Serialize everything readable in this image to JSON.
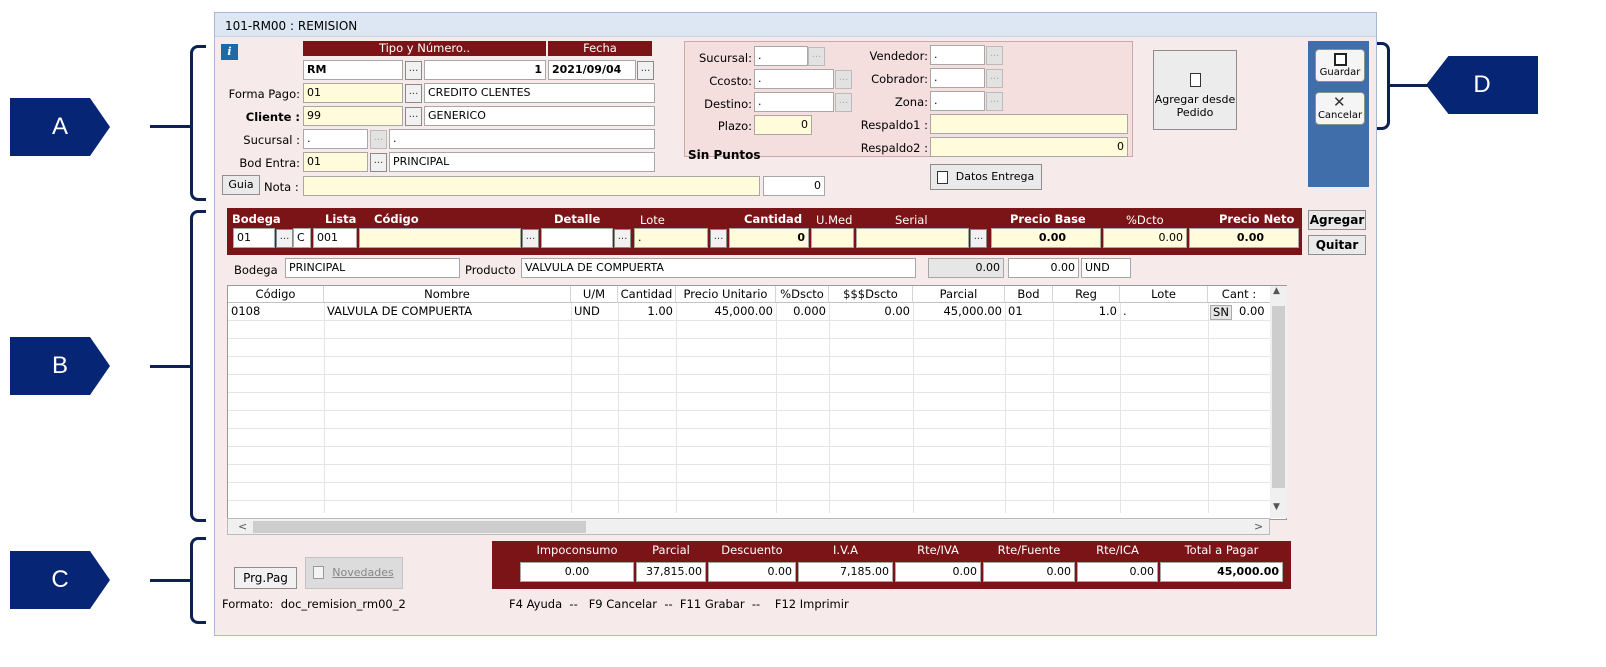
{
  "window": {
    "title": "101-RM00 : REMISION"
  },
  "header": {
    "tipo_numero_header": "Tipo y Número..",
    "fecha_header": "Fecha",
    "tipo": "RM",
    "numero": "1",
    "fecha": "2021/09/04",
    "forma_pago_label": "Forma Pago:",
    "forma_pago_code": "01",
    "forma_pago_name": "CREDITO CLENTES",
    "cliente_label": "Cliente :",
    "cliente_code": "99",
    "cliente_name": "GENERICO",
    "sucursal_label": "Sucursal :",
    "sucursal_code": ".",
    "sucursal_name": ".",
    "bod_entra_label": "Bod Entra:",
    "bod_entra_code": "01",
    "bod_entra_name": "PRINCIPAL",
    "guia_label": "Guia",
    "nota_label": "Nota :",
    "nota_value": "",
    "nota_num": "0"
  },
  "panel2": {
    "sucursal_label": "Sucursal:",
    "sucursal": ".",
    "ccosto_label": "Ccosto:",
    "ccosto": ".",
    "destino_label": "Destino:",
    "destino": ".",
    "plazo_label": "Plazo:",
    "plazo": "0",
    "vendedor_label": "Vendedor:",
    "vendedor": ".",
    "cobrador_label": "Cobrador:",
    "cobrador": ".",
    "zona_label": "Zona:",
    "zona": ".",
    "respaldo1_label": "Respaldo1 :",
    "respaldo1": "",
    "respaldo2_label": "Respaldo2 :",
    "respaldo2": "0",
    "sin_puntos": "Sin Puntos",
    "datos_entrega": "Datos Entrega",
    "agregar_pedido": "Agregar desde Pedido"
  },
  "toolbar": {
    "guardar": "Guardar",
    "cancelar": "Cancelar"
  },
  "entry": {
    "headers": {
      "bodega": "Bodega",
      "lista": "Lista",
      "codigo": "Código",
      "detalle": "Detalle",
      "lote": "Lote",
      "cantidad": "Cantidad",
      "umed": "U.Med",
      "serial": "Serial",
      "precio_base": "Precio Base",
      "dcto": "%Dcto",
      "precio_neto": "Precio Neto"
    },
    "bodega": "01",
    "lista": "C",
    "codigo": "001",
    "detalle": "",
    "lote": ".",
    "cantidad": "0",
    "umed": "",
    "serial": "",
    "precio_base": "0.00",
    "dcto": "0.00",
    "precio_neto": "0.00",
    "agregar": "Agregar",
    "quitar": "Quitar"
  },
  "info": {
    "bodega_label": "Bodega",
    "bodega": "PRINCIPAL",
    "producto_label": "Producto",
    "producto": "VALVULA DE COMPUERTA",
    "val1": "0.00",
    "val2": "0.00",
    "unidad": "UND"
  },
  "table": {
    "columns": [
      "Código",
      "Nombre",
      "U/M",
      "Cantidad",
      "Precio Unitario",
      "%Dscto",
      "$$$Dscto",
      "Parcial",
      "Bod",
      "Reg",
      "Lote",
      "Cant :"
    ],
    "rows": [
      [
        "0108",
        "VALVULA DE COMPUERTA",
        "UND",
        "1.00",
        "45,000.00",
        "0.000",
        "0.00",
        "45,000.00",
        "01",
        "1.0",
        ".",
        "SN",
        "0.00"
      ]
    ]
  },
  "totals": {
    "headers": [
      "Impoconsumo",
      "Parcial",
      "Descuento",
      "I.V.A",
      "Rte/IVA",
      "Rte/Fuente",
      "Rte/ICA",
      "Total a Pagar"
    ],
    "values": [
      "0.00",
      "37,815.00",
      "0.00",
      "7,185.00",
      "0.00",
      "0.00",
      "0.00",
      "45,000.00"
    ]
  },
  "footer": {
    "prg_pag": "Prg.Pag",
    "novedades": "Novedades",
    "formato": "Formato:  doc_remision_rm00_2",
    "shortcuts": "F4 Ayuda  --   F9 Cancelar  --  F11 Grabar  --    F12 Imprimir"
  },
  "callouts": {
    "a": "A",
    "b": "B",
    "c": "C",
    "d": "D"
  }
}
